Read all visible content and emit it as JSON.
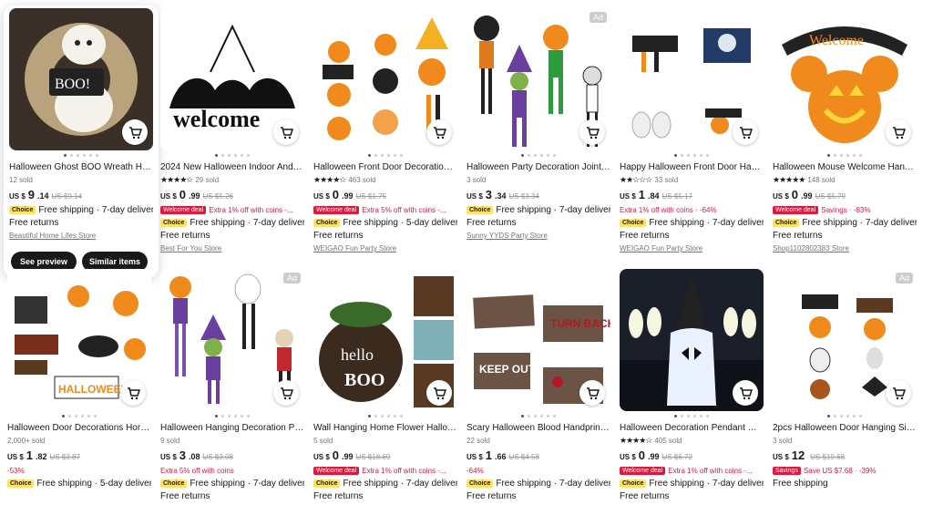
{
  "products": [
    {
      "title": "Halloween Ghost BOO Wreath Hallo...",
      "sold": "12 sold",
      "stars": "",
      "rating_count": "",
      "currency": "US $",
      "price_int": "9",
      "price_dec": ".14",
      "old": "US $9.14",
      "deal_badge": "",
      "deal_text": "",
      "choice": "Choice",
      "ship1": "Free shipping · 7-day delivery",
      "ship2": "Free returns",
      "store": "Beautiful Home Lifes Store",
      "ad": ""
    },
    {
      "title": "2024 New Halloween Indoor And O...",
      "sold": "",
      "stars": "★★★★☆",
      "rating_count": "29 sold",
      "currency": "US $",
      "price_int": "0",
      "price_dec": ".99",
      "old": "US $5.26",
      "deal_badge": "Welcome deal",
      "deal_text": "Extra 1% off with coins -...",
      "choice": "Choice",
      "ship1": "Free shipping · 7-day delivery",
      "ship2": "Free returns",
      "store": "Best For You Store",
      "ad": ""
    },
    {
      "title": "Halloween Front Door Decoration Si...",
      "sold": "",
      "stars": "★★★★☆",
      "rating_count": "463 sold",
      "currency": "US $",
      "price_int": "0",
      "price_dec": ".99",
      "old": "US $1.75",
      "deal_badge": "Welcome deal",
      "deal_text": "Extra 5% off with coins -...",
      "choice": "Choice",
      "ship1": "Free shipping · 5-day delivery",
      "ship2": "Free returns",
      "store": "WEIGAO Fun Party Store",
      "ad": ""
    },
    {
      "title": "Halloween Party Decoration Jointed ...",
      "sold": "3 sold",
      "stars": "",
      "rating_count": "",
      "currency": "US $",
      "price_int": "3",
      "price_dec": ".34",
      "old": "US $3.34",
      "deal_badge": "",
      "deal_text": "",
      "choice": "Choice",
      "ship1": "Free shipping · 7-day delivery",
      "ship2": "Free returns",
      "store": "Sunny YYDS Party Store",
      "ad": "Ad"
    },
    {
      "title": "Happy Halloween Front Door Hangi...",
      "sold": "",
      "stars": "★★☆☆☆",
      "rating_count": "33 sold",
      "currency": "US $",
      "price_int": "1",
      "price_dec": ".84",
      "old": "US $5.17",
      "deal_badge": "",
      "deal_text": "Extra 1% off with coins · -64%",
      "choice": "Choice",
      "ship1": "Free shipping · 7-day delivery",
      "ship2": "Free returns",
      "store": "WEIGAO Fun Party Store",
      "ad": ""
    },
    {
      "title": "Halloween Mouse Welcome Hangin...",
      "sold": "",
      "stars": "★★★★★",
      "rating_count": "148 sold",
      "currency": "US $",
      "price_int": "0",
      "price_dec": ".99",
      "old": "US $5.79",
      "deal_badge": "Welcome deal",
      "deal_text": "Savings · -83%",
      "choice": "Choice",
      "ship1": "Free shipping · 7-day delivery",
      "ship2": "Free returns",
      "store": "Shop1102802383 Store",
      "ad": ""
    },
    {
      "title": "Halloween Door Decorations Horror...",
      "sold": "2,000+ sold",
      "stars": "",
      "rating_count": "",
      "currency": "US $",
      "price_int": "1",
      "price_dec": ".82",
      "old": "US $3.87",
      "deal_badge": "",
      "deal_text": "-53%",
      "choice": "Choice",
      "ship1": "Free shipping · 5-day delivery",
      "ship2": "",
      "store": "",
      "ad": ""
    },
    {
      "title": "Halloween Hanging Decoration Pap...",
      "sold": "9 sold",
      "stars": "",
      "rating_count": "",
      "currency": "US $",
      "price_int": "3",
      "price_dec": ".08",
      "old": "US $3.08",
      "deal_badge": "",
      "deal_text": "Extra 5% off with coins",
      "choice": "Choice",
      "ship1": "Free shipping · 7-day delivery",
      "ship2": "Free returns",
      "store": "",
      "ad": "Ad"
    },
    {
      "title": "Wall Hanging Home Flower Hallowe...",
      "sold": "5 sold",
      "stars": "",
      "rating_count": "",
      "currency": "US $",
      "price_int": "0",
      "price_dec": ".99",
      "old": "US $18.69",
      "deal_badge": "Welcome deal",
      "deal_text": "Extra 1% off with coins -...",
      "choice": "Choice",
      "ship1": "Free shipping · 7-day delivery",
      "ship2": "Free returns",
      "store": "",
      "ad": ""
    },
    {
      "title": "Scary Halloween Blood Handprint P...",
      "sold": "22 sold",
      "stars": "",
      "rating_count": "",
      "currency": "US $",
      "price_int": "1",
      "price_dec": ".66",
      "old": "US $4.58",
      "deal_badge": "",
      "deal_text": "-64%",
      "choice": "Choice",
      "ship1": "Free shipping · 7-day delivery",
      "ship2": "Free returns",
      "store": "",
      "ad": ""
    },
    {
      "title": "Halloween Decoration Pendant Out...",
      "sold": "",
      "stars": "★★★★☆",
      "rating_count": "405 sold",
      "currency": "US $",
      "price_int": "0",
      "price_dec": ".99",
      "old": "US $6.72",
      "deal_badge": "Welcome deal",
      "deal_text": "Extra 1% off with coins -...",
      "choice": "Choice",
      "ship1": "Free shipping · 7-day delivery",
      "ship2": "Free returns",
      "store": "",
      "ad": ""
    },
    {
      "title": "2pcs Halloween Door Hanging Sign ...",
      "sold": "3 sold",
      "stars": "",
      "rating_count": "",
      "currency": "US $",
      "price_int": "12",
      "price_dec": "",
      "old": "US $19.68",
      "deal_badge": "Savings",
      "deal_text": "Save US $7.68 · -39%",
      "choice": "",
      "ship1": "Free shipping",
      "ship2": "",
      "store": "",
      "ad": "Ad"
    }
  ],
  "hover_actions": {
    "preview": "See preview",
    "similar": "Similar items"
  },
  "colors": {
    "accent_red": "#e0193c",
    "choice_yellow": "#fde26a",
    "dark": "#191919"
  }
}
